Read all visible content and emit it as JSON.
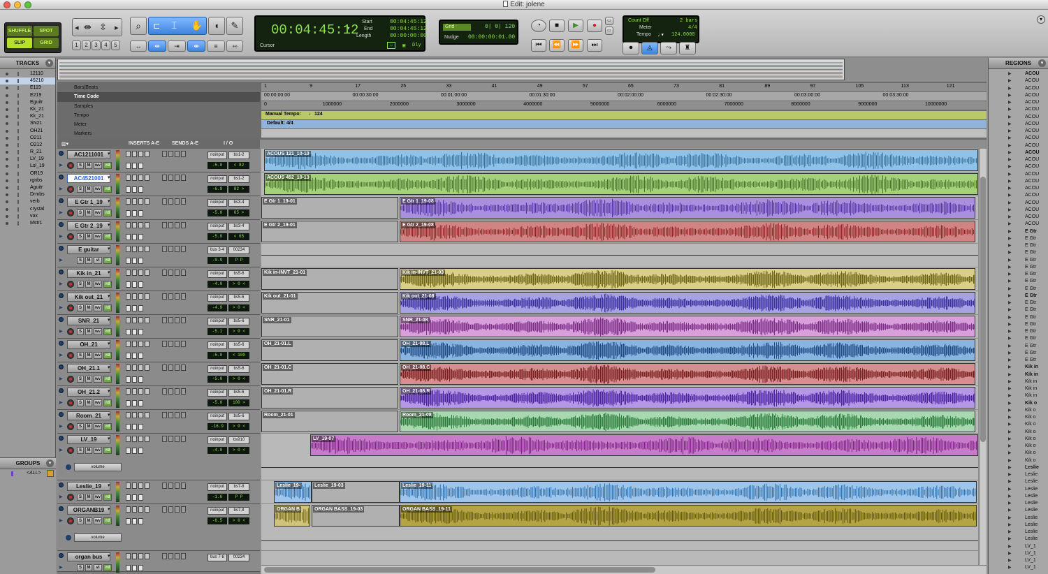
{
  "window_title": "Edit: jolene",
  "edit_modes": {
    "shuffle": "SHUFFLE",
    "spot": "SPOT",
    "slip": "SLIP",
    "grid": "GRID"
  },
  "zoom_presets": [
    "1",
    "2",
    "3",
    "4",
    "5"
  ],
  "counter": {
    "main": "00:04:45:12",
    "start_label": "Start",
    "end_label": "End",
    "length_label": "Length",
    "start": "00:04:45:12",
    "end": "00:04:45:12",
    "length": "00:00:00:00",
    "cursor_label": "Cursor",
    "dly": "Dly"
  },
  "grid": {
    "label": "Grid",
    "value": "0| 0| 120",
    "nudge_label": "Nudge",
    "nudge_value": "00:00:00:01.00"
  },
  "midi": {
    "count_off": "Count Off",
    "count_bars": "2 bars",
    "meter_label": "Meter",
    "meter_value": "4/4",
    "tempo_label": "Tempo",
    "tempo_value": "124.0000"
  },
  "tracks_panel": {
    "title": "TRACKS",
    "items": [
      "12110",
      "45210",
      "E119",
      "E219",
      "Eguitr",
      "Kk_21",
      "Kk_21",
      "SN21",
      "OH21",
      "O211",
      "O212",
      "R_21",
      "LV_19",
      "Lsl_19",
      "OR19",
      "rgnbs",
      "Aguitr",
      "Drmbs",
      "verb",
      "crystal",
      "vox",
      "Mstr1"
    ]
  },
  "groups_panel": {
    "title": "GROUPS",
    "items": [
      "<ALL>"
    ]
  },
  "regions_panel": {
    "title": "REGIONS",
    "items": [
      "ACOU",
      "ACOU",
      "ACOU",
      "ACOU",
      "ACOU",
      "ACOU",
      "ACOU",
      "ACOU",
      "ACOU",
      "ACOU",
      "ACOU",
      "ACOU",
      "ACOU",
      "ACOU",
      "ACOU",
      "ACOU",
      "ACOU",
      "ACOU",
      "ACOU",
      "ACOU",
      "ACOU",
      "ACOU",
      "E Gtr",
      "E Gtr",
      "E Gtr",
      "E Gtr",
      "E Gtr",
      "E Gtr",
      "E Gtr",
      "E Gtr",
      "E Gtr",
      "E Gtr",
      "E Gtr",
      "E Gtr",
      "E Gtr",
      "E Gtr",
      "E Gtr",
      "E Gtr",
      "E Gtr",
      "E Gtr",
      "E Gtr",
      "Kik in",
      "Kik in",
      "Kik in",
      "Kik in",
      "Kik in",
      "Kik o",
      "Kik o",
      "Kik o",
      "Kik o",
      "Kik o",
      "Kik o",
      "Kik o",
      "Kik o",
      "Kik o",
      "Leslie",
      "Leslie",
      "Leslie",
      "Leslie",
      "Leslie",
      "Leslie",
      "Leslie",
      "Leslie",
      "Leslie",
      "Leslie",
      "Leslie",
      "LV_1",
      "LV_1",
      "LV_1",
      "LV_1"
    ]
  },
  "rulers": {
    "rows": [
      "Bars|Beats",
      "Time Code",
      "Samples",
      "Tempo",
      "Meter",
      "Markers"
    ],
    "bars": [
      "1",
      "9",
      "17",
      "25",
      "33",
      "41",
      "49",
      "57",
      "65",
      "73",
      "81",
      "89",
      "97",
      "105",
      "113",
      "121"
    ],
    "timecode": [
      "00:00:00:00",
      "00:00:30:00",
      "00:01:00:00",
      "00:01:30:00",
      "00:02:00:00",
      "00:02:30:00",
      "00:03:00:00",
      "00:03:30:00"
    ],
    "samples": [
      "0",
      "1000000",
      "2000000",
      "3000000",
      "4000000",
      "5000000",
      "6000000",
      "7000000",
      "8000000",
      "9000000",
      "10000000"
    ],
    "tempo_text": "Manual Tempo:",
    "tempo_value": "124",
    "meter_text": "Default: 4/4"
  },
  "mix_header": {
    "inserts": "INSERTS A-E",
    "sends": "SENDS A-E",
    "io": "I / O"
  },
  "tracks": [
    {
      "name": "AC1211001",
      "input": "noinput",
      "output": "bs1-2",
      "vol": "-5.0",
      "pan": "< 82",
      "clips": [
        {
          "name": "ACOUS 121_10-10",
          "color": "#8fc2e6",
          "wave": "#2f6a99"
        }
      ]
    },
    {
      "name": "AC4521001",
      "input": "noinput",
      "output": "bs1-2",
      "vol": "-6.9",
      "pan": "82 >",
      "clips": [
        {
          "name": "ACOUS 452_10-10",
          "color": "#a6d17c",
          "wave": "#3e6b22"
        }
      ]
    },
    {
      "name": "E Gtr 1_19",
      "input": "noinput",
      "output": "bs3-4",
      "vol": "-5.0",
      "pan": "65 >",
      "clips": [
        {
          "name": "E Gtr 1_19-01",
          "color": "",
          "wave": ""
        },
        {
          "name": "E Gtr 1_19-08",
          "color": "#a98fe0",
          "wave": "#4b2a9a"
        }
      ]
    },
    {
      "name": "E Gtr 2_19",
      "input": "noinput",
      "output": "bs3-4",
      "vol": "-5.0",
      "pan": "< 65",
      "clips": [
        {
          "name": "E Gtr 2_19-01",
          "color": "",
          "wave": ""
        },
        {
          "name": "E Gtr 2_19-08",
          "color": "#d28484",
          "wave": "#8a1c1c"
        }
      ]
    },
    {
      "name": "E guitar",
      "input": "bus 3-4",
      "output": "00234",
      "vol": "-9.9",
      "pan": "P P",
      "clips": []
    },
    {
      "name": "Kik in_21",
      "input": "noinput",
      "output": "bs5-6",
      "vol": "-4.0",
      "pan": "> 0 <",
      "clips": [
        {
          "name": "Kik in-INVT_21-01",
          "color": "",
          "wave": ""
        },
        {
          "name": "Kik in-INVT_21-03",
          "color": "#d9cf8a",
          "wave": "#6f6414"
        }
      ]
    },
    {
      "name": "Kik out_21",
      "input": "noinput",
      "output": "bs5-6",
      "vol": "-4.9",
      "pan": "> 0 <",
      "clips": [
        {
          "name": "Kik out_21-01",
          "color": "",
          "wave": ""
        },
        {
          "name": "Kik out_21-08",
          "color": "#a6a2e4",
          "wave": "#3a2f9e"
        }
      ]
    },
    {
      "name": "SNR_21",
      "input": "noinput",
      "output": "bs5-6",
      "vol": "-5.1",
      "pan": "> 0 <",
      "clips": [
        {
          "name": "SNR_21-01",
          "color": "",
          "wave": ""
        },
        {
          "name": "SNR_21-08",
          "color": "#d7a0da",
          "wave": "#7c2c86"
        }
      ]
    },
    {
      "name": "OH_21",
      "input": "noinput",
      "output": "bs5-6",
      "vol": "-5.0",
      "pan": "< 100",
      "clips": [
        {
          "name": "OH_21-01.L",
          "color": "",
          "wave": ""
        },
        {
          "name": "OH_21-08.L",
          "color": "#8ab4e0",
          "wave": "#1f4b86"
        }
      ]
    },
    {
      "name": "OH_21.1",
      "input": "noinput",
      "output": "bs5-6",
      "vol": "-5.0",
      "pan": "> 0 <",
      "clips": [
        {
          "name": "OH_21-01.C",
          "color": "",
          "wave": ""
        },
        {
          "name": "OH_21-08.C",
          "color": "#d49090",
          "wave": "#7a1e1e"
        }
      ]
    },
    {
      "name": "OH_21.2",
      "input": "noinput",
      "output": "bs5-6",
      "vol": "-5.0",
      "pan": "100 >",
      "clips": [
        {
          "name": "OH_21-01.R",
          "color": "",
          "wave": ""
        },
        {
          "name": "OH_21-08.R",
          "color": "#b497e6",
          "wave": "#4a23a0"
        }
      ]
    },
    {
      "name": "Room_21",
      "input": "noinput",
      "output": "bs5-6",
      "vol": "-16.9",
      "pan": "> 0 <",
      "clips": [
        {
          "name": "Room_21-01",
          "color": "",
          "wave": ""
        },
        {
          "name": "Room_21-08",
          "color": "#a8d8b0",
          "wave": "#2a7a3a"
        }
      ]
    },
    {
      "name": "LV_19",
      "input": "noinput",
      "output": "bs910",
      "vol": "-4.0",
      "pan": "> 0 <",
      "automation": "volume",
      "clips": [
        {
          "name": "LV_19-07",
          "color": "#c77cc9",
          "wave": "#7a1a80"
        }
      ]
    },
    {
      "name": "Leslie_19",
      "input": "noinput",
      "output": "bs7-8",
      "vol": "-1.6",
      "pan": "P P",
      "clips": [
        {
          "name": "Leslie_19-",
          "color": "#9ec6ec",
          "wave": "#2a6aa6"
        },
        {
          "name": "Leslie_19-03",
          "color": "",
          "wave": ""
        },
        {
          "name": "Leslie_19-11",
          "color": "#9ec6ec",
          "wave": "#2a6aa6"
        }
      ]
    },
    {
      "name": "ORGANB19",
      "input": "noinput",
      "output": "bs7-8",
      "vol": "-6.5",
      "pan": "> 0 <",
      "automation": "volume",
      "clips": [
        {
          "name": "ORGAN B",
          "color": "#cfc27a",
          "wave": "#6e6410"
        },
        {
          "name": "ORGAN BASS_19-03",
          "color": "",
          "wave": ""
        },
        {
          "name": "ORGAN BASS_19-11",
          "color": "#b4a444",
          "wave": "#5c520a"
        }
      ]
    },
    {
      "name": "organ bus",
      "input": "bus 7-8",
      "output": "00234",
      "vol": "",
      "pan": "",
      "clips": []
    }
  ]
}
